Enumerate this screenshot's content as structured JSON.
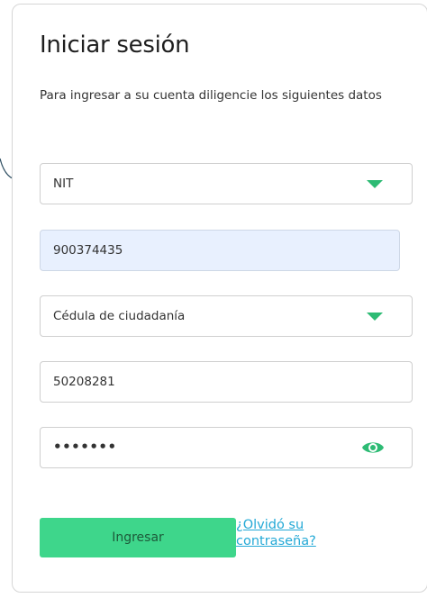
{
  "login": {
    "title": "Iniciar sesión",
    "subtitle": "Para ingresar a su cuenta diligencie los siguientes datos",
    "company_doc_type": {
      "selected": "NIT"
    },
    "company_doc_number": {
      "value": "900374435"
    },
    "person_doc_type": {
      "selected": "Cédula de ciudadanía"
    },
    "person_doc_number": {
      "value": "50208281"
    },
    "password": {
      "masked_value": "•••••••",
      "toggle_icon": "eye-icon"
    },
    "submit_label": "Ingresar",
    "forgot_password_label": "¿Olvidó su contraseña?"
  },
  "colors": {
    "accent": "#3ed68b",
    "icon_green": "#2dbb74",
    "link": "#24a9d6",
    "autofill_bg": "#e8f0fe",
    "connector": "#2f4f63"
  }
}
